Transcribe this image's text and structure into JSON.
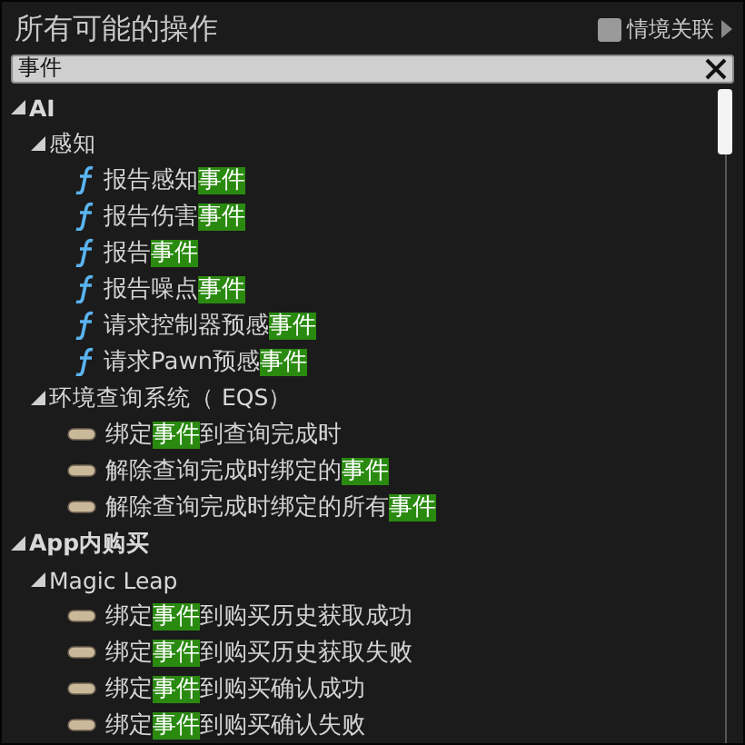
{
  "title": "所有可能的操作",
  "context_toggle": {
    "label": "情境关联",
    "checked": false
  },
  "search": {
    "value": "事件"
  },
  "tree": [
    {
      "label": "AI",
      "expanded": true,
      "children": [
        {
          "label": "感知",
          "expanded": true,
          "children": [
            {
              "kind": "function",
              "parts": [
                {
                  "text": "报告感知",
                  "match": false
                },
                {
                  "text": "事件",
                  "match": true
                }
              ]
            },
            {
              "kind": "function",
              "parts": [
                {
                  "text": "报告伤害",
                  "match": false
                },
                {
                  "text": "事件",
                  "match": true
                }
              ]
            },
            {
              "kind": "function",
              "parts": [
                {
                  "text": "报告",
                  "match": false
                },
                {
                  "text": "事件",
                  "match": true
                }
              ]
            },
            {
              "kind": "function",
              "parts": [
                {
                  "text": "报告噪点",
                  "match": false
                },
                {
                  "text": "事件",
                  "match": true
                }
              ]
            },
            {
              "kind": "function",
              "parts": [
                {
                  "text": "请求控制器预感",
                  "match": false
                },
                {
                  "text": "事件",
                  "match": true
                }
              ]
            },
            {
              "kind": "function",
              "parts": [
                {
                  "text": "请求Pawn预感",
                  "match": false
                },
                {
                  "text": "事件",
                  "match": true
                }
              ]
            }
          ]
        },
        {
          "label": "环境查询系统（ EQS）",
          "expanded": true,
          "children": [
            {
              "kind": "delegate",
              "parts": [
                {
                  "text": "绑定",
                  "match": false
                },
                {
                  "text": "事件",
                  "match": true
                },
                {
                  "text": "到查询完成时",
                  "match": false
                }
              ]
            },
            {
              "kind": "delegate",
              "parts": [
                {
                  "text": "解除查询完成时绑定的",
                  "match": false
                },
                {
                  "text": "事件",
                  "match": true
                }
              ]
            },
            {
              "kind": "delegate",
              "parts": [
                {
                  "text": "解除查询完成时绑定的所有",
                  "match": false
                },
                {
                  "text": "事件",
                  "match": true
                }
              ]
            }
          ]
        }
      ]
    },
    {
      "label": "App内购买",
      "expanded": true,
      "children": [
        {
          "label": "Magic Leap",
          "expanded": true,
          "children": [
            {
              "kind": "delegate",
              "parts": [
                {
                  "text": "绑定",
                  "match": false
                },
                {
                  "text": "事件",
                  "match": true
                },
                {
                  "text": "到购买历史获取成功",
                  "match": false
                }
              ]
            },
            {
              "kind": "delegate",
              "parts": [
                {
                  "text": "绑定",
                  "match": false
                },
                {
                  "text": "事件",
                  "match": true
                },
                {
                  "text": "到购买历史获取失败",
                  "match": false
                }
              ]
            },
            {
              "kind": "delegate",
              "parts": [
                {
                  "text": "绑定",
                  "match": false
                },
                {
                  "text": "事件",
                  "match": true
                },
                {
                  "text": "到购买确认成功",
                  "match": false
                }
              ]
            },
            {
              "kind": "delegate",
              "parts": [
                {
                  "text": "绑定",
                  "match": false
                },
                {
                  "text": "事件",
                  "match": true
                },
                {
                  "text": "到购买确认失败",
                  "match": false
                }
              ]
            }
          ]
        }
      ]
    }
  ]
}
